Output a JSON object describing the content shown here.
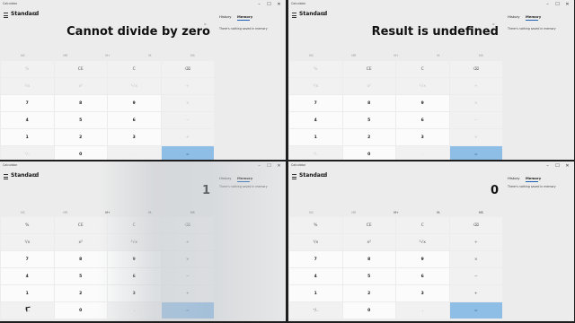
{
  "app": {
    "title": "Calculator",
    "mode": "Standard",
    "tabs": {
      "history": "History",
      "memory": "Memory"
    },
    "memory_empty": "There's nothing saved in memory",
    "history_mini": "⊙",
    "accent": "#1a5fb4",
    "equals_color": "#8ebde6"
  },
  "windows": [
    {
      "display": "Cannot divide by zero"
    },
    {
      "display": "Result is undefined"
    },
    {
      "display": "1"
    },
    {
      "display": "0"
    }
  ],
  "memory_row": [
    "MC",
    "MR",
    "M+",
    "M-",
    "MS"
  ],
  "keys_error": [
    "%",
    "CE",
    "C",
    "⌫",
    "¹/x",
    "x²",
    "²√x",
    "÷",
    "7",
    "8",
    "9",
    "×",
    "4",
    "5",
    "6",
    "−",
    "1",
    "2",
    "3",
    "+",
    "⁺/₋",
    "0",
    ".",
    "="
  ],
  "keys_normal": [
    "%",
    "CE",
    "C",
    "⌫",
    "¹/x",
    "x²",
    "²√x",
    "÷",
    "7",
    "8",
    "9",
    "×",
    "4",
    "5",
    "6",
    "−",
    "1",
    "2",
    "3",
    "+",
    "⁺/₋",
    "0",
    ".",
    "="
  ],
  "window_controls": [
    "–",
    "☐",
    "✕"
  ],
  "icons": {
    "menu": "hamburger-icon",
    "keep_on_top": "keep-on-top-icon"
  }
}
